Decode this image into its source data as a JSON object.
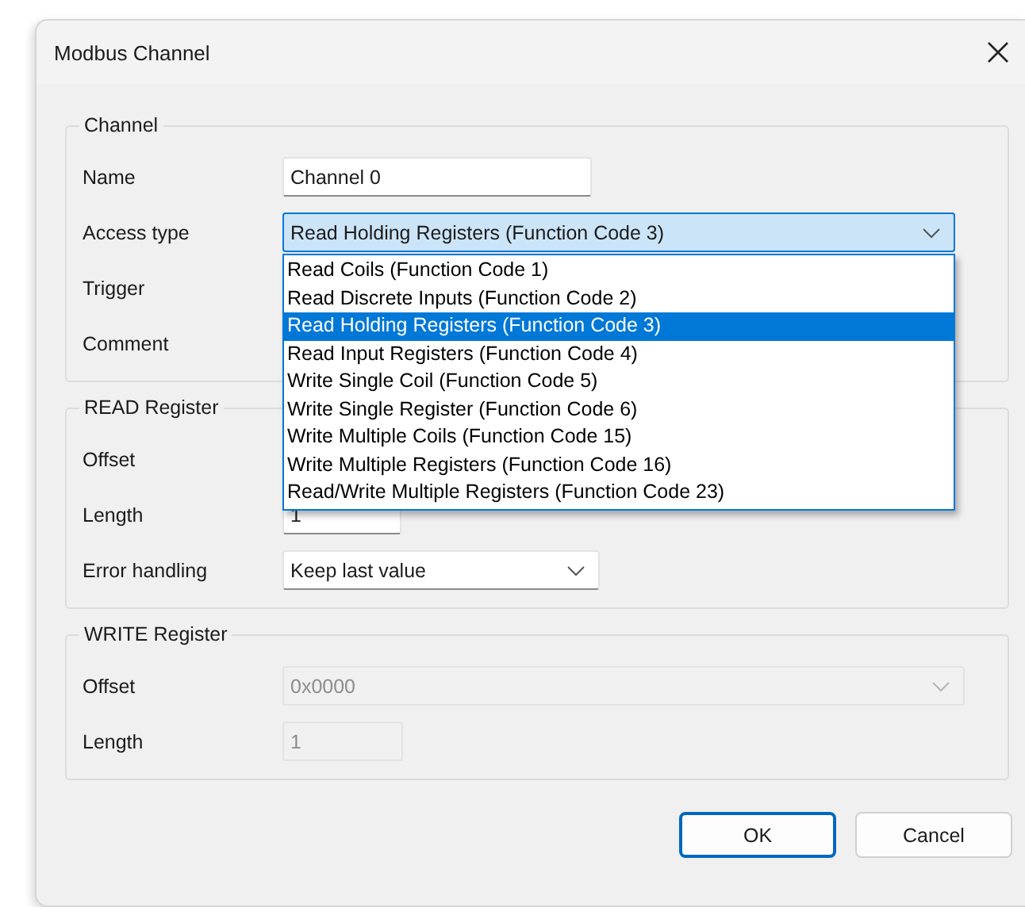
{
  "window": {
    "title": "Modbus Channel"
  },
  "groups": [
    {
      "legend": "Channel",
      "rows": [
        {
          "kind": "text",
          "label": "Name",
          "value": "Channel 0",
          "disabled": false
        },
        {
          "kind": "combo",
          "label": "Access type",
          "value": "Read Holding Registers (Function Code 3)",
          "disabled": false,
          "expanded": true,
          "options": [
            {
              "label": "Read Coils (Function Code 1)",
              "selected": false
            },
            {
              "label": "Read Discrete Inputs (Function Code 2)",
              "selected": false
            },
            {
              "label": "Read Holding Registers (Function Code 3)",
              "selected": true
            },
            {
              "label": "Read Input Registers (Function Code 4)",
              "selected": false
            },
            {
              "label": "Write Single Coil (Function Code 5)",
              "selected": false
            },
            {
              "label": "Write Single Register (Function Code 6)",
              "selected": false
            },
            {
              "label": "Write Multiple Coils (Function Code 15)",
              "selected": false
            },
            {
              "label": "Write Multiple Registers (Function Code 16)",
              "selected": false
            },
            {
              "label": "Read/Write Multiple Registers (Function Code 23)",
              "selected": false
            }
          ]
        },
        {
          "kind": "label",
          "label": "Trigger"
        },
        {
          "kind": "label",
          "label": "Comment"
        }
      ]
    },
    {
      "legend": "READ Register",
      "rows": [
        {
          "kind": "label",
          "label": "Offset"
        },
        {
          "kind": "text",
          "label": "Length",
          "value": "1",
          "disabled": false
        },
        {
          "kind": "combo",
          "label": "Error handling",
          "value": "Keep last value",
          "disabled": false,
          "expanded": false
        }
      ]
    },
    {
      "legend": "WRITE Register",
      "rows": [
        {
          "kind": "combo",
          "label": "Offset",
          "value": "0x0000",
          "disabled": true,
          "expanded": false
        },
        {
          "kind": "text",
          "label": "Length",
          "value": "1",
          "disabled": true
        }
      ]
    }
  ],
  "buttons": [
    {
      "label": "OK",
      "default": true
    },
    {
      "label": "Cancel",
      "default": false
    }
  ]
}
